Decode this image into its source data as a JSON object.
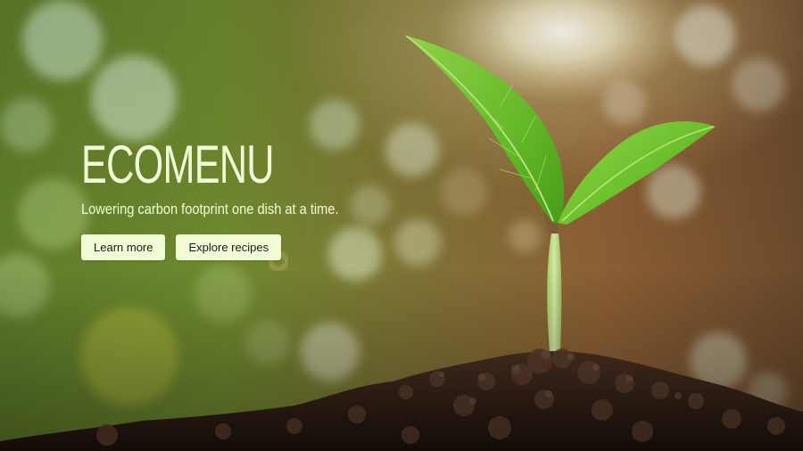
{
  "colors": {
    "hero_text": "#f1fbd6",
    "button_bg": "#f1fbd6",
    "button_text": "#1a1a1a",
    "leaf_green": "#7fd13a",
    "soil_dark": "#2b1a12",
    "bg_green": "#6d8a2d",
    "bg_brown": "#7a5230"
  },
  "hero": {
    "title": "ECOMENU",
    "tagline": "Lowering carbon footprint one dish at a time.",
    "buttons": {
      "learn_more": "Learn more",
      "explore_recipes": "Explore recipes"
    }
  },
  "background": {
    "icon": "seedling-in-soil-photo"
  }
}
